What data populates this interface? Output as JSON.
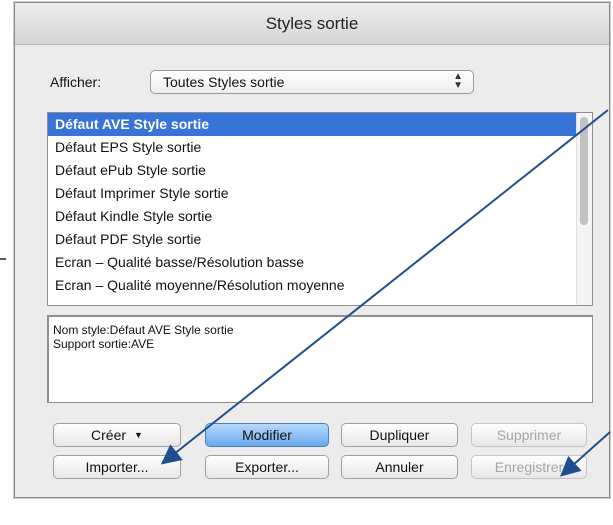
{
  "window": {
    "title": "Styles sortie"
  },
  "filter": {
    "label": "Afficher:",
    "selected": "Toutes Styles sortie"
  },
  "styles_list": {
    "items": [
      "Défaut AVE Style sortie",
      "Défaut EPS Style sortie",
      "Défaut ePub Style sortie",
      "Défaut Imprimer Style sortie",
      "Défaut Kindle Style sortie",
      "Défaut PDF Style sortie",
      "Ecran – Qualité basse/Résolution basse",
      "Ecran – Qualité moyenne/Résolution moyenne"
    ],
    "selected_index": 0
  },
  "details": {
    "line1": "Nom style:Défaut AVE Style sortie",
    "line2": "Support sortie:AVE"
  },
  "buttons": {
    "creer": "Créer",
    "modifier": "Modifier",
    "dupliquer": "Dupliquer",
    "supprimer": "Supprimer",
    "importer": "Importer...",
    "exporter": "Exporter...",
    "annuler": "Annuler",
    "enregistrer": "Enregistrer"
  },
  "colors": {
    "selection": "#3874d8",
    "default_button": "#6aa8ee",
    "annotation_arrow": "#1f4f8f"
  }
}
